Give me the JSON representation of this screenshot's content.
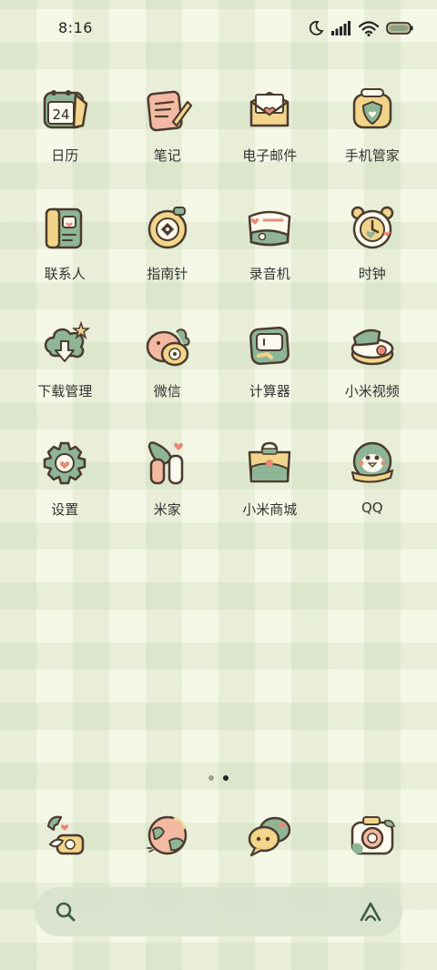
{
  "status_bar": {
    "time": "8:16",
    "icons": [
      "moon-icon",
      "signal-icon",
      "wifi-icon",
      "battery-icon"
    ]
  },
  "apps": [
    {
      "label": "日历",
      "icon": "calendar-icon",
      "date": "24"
    },
    {
      "label": "笔记",
      "icon": "notes-icon"
    },
    {
      "label": "电子邮件",
      "icon": "email-icon"
    },
    {
      "label": "手机管家",
      "icon": "security-icon"
    },
    {
      "label": "联系人",
      "icon": "contacts-icon"
    },
    {
      "label": "指南针",
      "icon": "compass-icon"
    },
    {
      "label": "录音机",
      "icon": "recorder-icon"
    },
    {
      "label": "时钟",
      "icon": "clock-icon"
    },
    {
      "label": "下载管理",
      "icon": "download-icon"
    },
    {
      "label": "微信",
      "icon": "wechat-icon"
    },
    {
      "label": "计算器",
      "icon": "calculator-icon"
    },
    {
      "label": "小米视频",
      "icon": "video-icon"
    },
    {
      "label": "设置",
      "icon": "settings-icon"
    },
    {
      "label": "米家",
      "icon": "mijia-icon"
    },
    {
      "label": "小米商城",
      "icon": "store-icon"
    },
    {
      "label": "QQ",
      "icon": "qq-icon"
    }
  ],
  "page_indicator": {
    "count": 2,
    "active_index": 1
  },
  "dock": [
    {
      "icon": "phone-icon"
    },
    {
      "icon": "browser-icon"
    },
    {
      "icon": "messages-icon"
    },
    {
      "icon": "camera-icon"
    }
  ],
  "search_bar": {
    "left_icon": "search-icon",
    "right_icon": "assistant-icon"
  },
  "colors": {
    "background": "#f5f8e6",
    "icon_green": "#8fb597",
    "icon_yellow": "#f2d58a",
    "icon_pink": "#f3b9a3",
    "outline": "#4a3b2e"
  }
}
